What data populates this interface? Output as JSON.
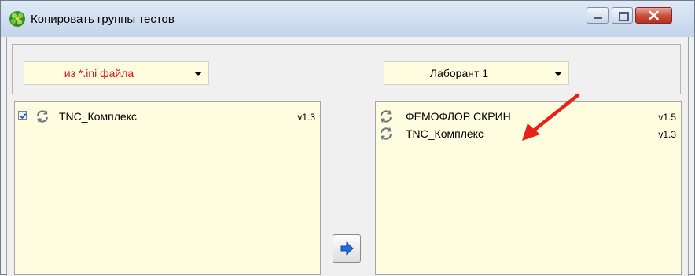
{
  "window": {
    "title": "Копировать группы тестов",
    "app_icon": "green-bead-icon"
  },
  "window_controls": {
    "minimize": "minimize-icon",
    "maximize": "maximize-icon",
    "close": "close-icon"
  },
  "source_select": {
    "value": "из *.ini файла",
    "color": "#e01010"
  },
  "target_select": {
    "value": "Лаборант 1"
  },
  "left_list": {
    "items": [
      {
        "name": "TNC_Комплекс",
        "version": "v1.3",
        "checked": true
      }
    ]
  },
  "right_list": {
    "items": [
      {
        "name": "ФЕМОФЛОР СКРИН",
        "version": "v1.5"
      },
      {
        "name": "TNC_Комплекс",
        "version": "v1.3"
      }
    ]
  },
  "transfer_button": {
    "icon": "arrow-right-icon"
  },
  "colors": {
    "list_bg": "#fffde0",
    "annotation_arrow": "#e8201a",
    "transfer_arrow": "#1e6fd9"
  }
}
